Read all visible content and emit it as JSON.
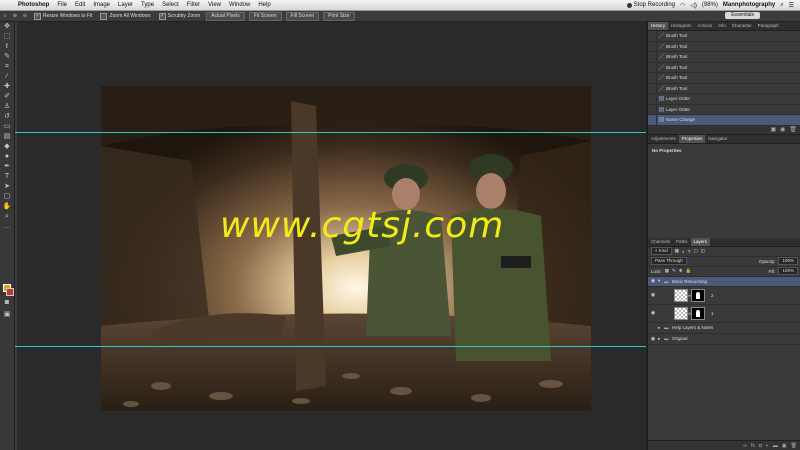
{
  "menubar": {
    "apple": "",
    "app": "Photoshop",
    "items": [
      "File",
      "Edit",
      "Image",
      "Layer",
      "Type",
      "Select",
      "Filter",
      "View",
      "Window",
      "Help"
    ],
    "recording": "Stop Recording",
    "battery": "(98%)",
    "user": "Mannphotography"
  },
  "options_bar": {
    "checks": [
      "Resize Windows to Fit",
      "Zoom All Windows",
      "Scrubby Zoom"
    ],
    "buttons": [
      "Actual Pixels",
      "Fit Screen",
      "Fill Screen",
      "Print Size"
    ],
    "workspace": "Essentials"
  },
  "canvas": {
    "watermark": "www.cgtsj.com"
  },
  "history_panel": {
    "tabs": [
      "History",
      "Histogram",
      "Actions",
      "Info",
      "Character",
      "Paragraph"
    ],
    "items": [
      {
        "label": "Brush Tool"
      },
      {
        "label": "Brush Tool"
      },
      {
        "label": "Brush Tool"
      },
      {
        "label": "Brush Tool"
      },
      {
        "label": "Brush Tool"
      },
      {
        "label": "Brush Tool"
      },
      {
        "label": "Layer Order"
      },
      {
        "label": "Layer Order"
      },
      {
        "label": "Name Change"
      }
    ]
  },
  "properties_panel": {
    "tabs": [
      "Adjustments",
      "Properties",
      "Navigator"
    ],
    "status": "No Properties"
  },
  "layers_panel": {
    "tabs": [
      "Channels",
      "Paths",
      "Layers"
    ],
    "kind": "Kind",
    "blend_mode": "Pass Through",
    "opacity_label": "Opacity:",
    "opacity_value": "100%",
    "lock_label": "Lock:",
    "fill_label": "Fill:",
    "fill_value": "100%",
    "group_active": "Basic Retouching",
    "group_help": "Help Layers & Notes",
    "group_original": "Original",
    "layer_num_1": "2",
    "layer_num_2": "1"
  },
  "colors": {
    "foreground": "#e8a21c",
    "background": "#c0392b",
    "guide": "#33c6c6",
    "watermark": "#f4ea17"
  }
}
